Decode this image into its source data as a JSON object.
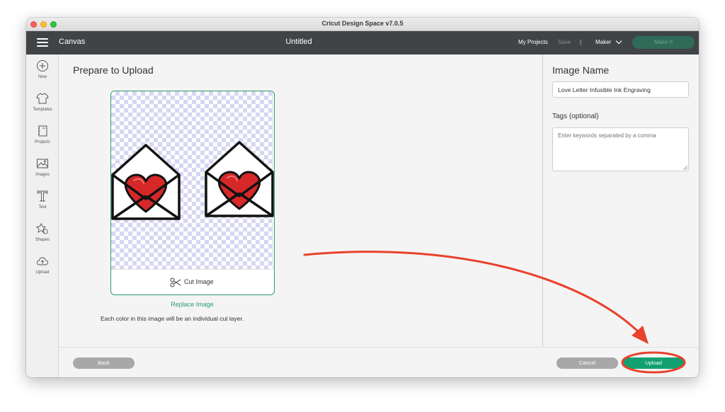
{
  "window": {
    "title": "Cricut Design Space  v7.0.5"
  },
  "navbar": {
    "canvas_label": "Canvas",
    "document_title": "Untitled",
    "my_projects": "My Projects",
    "save": "Save",
    "separator": "|",
    "machine": "Maker",
    "make_it": "Make It"
  },
  "sidebar": {
    "items": [
      {
        "label": "New",
        "icon": "plus-circle-icon"
      },
      {
        "label": "Templates",
        "icon": "shirt-icon"
      },
      {
        "label": "Projects",
        "icon": "notebook-icon"
      },
      {
        "label": "Images",
        "icon": "image-icon"
      },
      {
        "label": "Text",
        "icon": "text-t-icon"
      },
      {
        "label": "Shapes",
        "icon": "shapes-icon"
      },
      {
        "label": "Upload",
        "icon": "cloud-upload-icon"
      }
    ]
  },
  "main": {
    "title": "Prepare to Upload",
    "cut_option": "Cut Image",
    "replace_link": "Replace Image",
    "info": "Each color in this image will be an individual cut layer."
  },
  "right_panel": {
    "image_name_label": "Image Name",
    "image_name_value": "Love Letter Infusible Ink Engraving",
    "tags_label": "Tags (optional)",
    "tags_placeholder": "Enter keywords separated by a comma"
  },
  "footer": {
    "back": "Back",
    "cancel": "Cancel",
    "upload": "Upload"
  },
  "colors": {
    "accent_green": "#12a070",
    "heart_red": "#d62828",
    "annotation_red": "#e8412c",
    "navbar_bg": "#414447"
  }
}
